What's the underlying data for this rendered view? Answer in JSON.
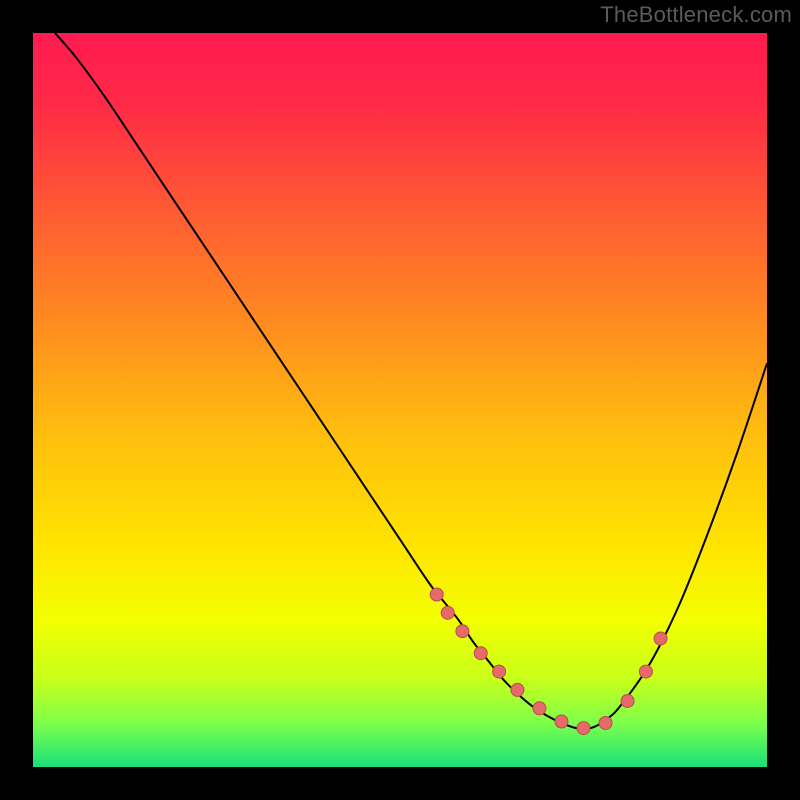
{
  "watermark": "TheBottleneck.com",
  "gradient": {
    "stops": [
      {
        "offset": 0.0,
        "color": "#ff1a51"
      },
      {
        "offset": 0.1,
        "color": "#ff2b46"
      },
      {
        "offset": 0.25,
        "color": "#ff5d32"
      },
      {
        "offset": 0.4,
        "color": "#ff8d1f"
      },
      {
        "offset": 0.55,
        "color": "#ffbf0e"
      },
      {
        "offset": 0.7,
        "color": "#ffe500"
      },
      {
        "offset": 0.8,
        "color": "#f3ff00"
      },
      {
        "offset": 0.88,
        "color": "#c8ff1a"
      },
      {
        "offset": 0.94,
        "color": "#7dff4a"
      },
      {
        "offset": 1.0,
        "color": "#18e07a"
      }
    ]
  },
  "curve_color": "#000000",
  "dot_fill": "#e66a6a",
  "dot_stroke": "#b94c4c",
  "chart_data": {
    "type": "line",
    "title": "",
    "xlabel": "",
    "ylabel": "",
    "xlim": [
      0,
      100
    ],
    "ylim": [
      0,
      100
    ],
    "series": [
      {
        "name": "curve",
        "x": [
          3,
          6,
          10,
          14,
          18,
          22,
          26,
          30,
          34,
          38,
          42,
          46,
          50,
          54,
          56,
          58,
          60,
          62,
          64,
          66,
          68,
          70,
          72,
          74,
          76,
          78,
          80,
          84,
          88,
          92,
          96,
          100
        ],
        "y": [
          100,
          96.5,
          91,
          85,
          79,
          73,
          67,
          61,
          55,
          49,
          43,
          37,
          31,
          25,
          22.5,
          20,
          17,
          14.5,
          12,
          10,
          8.3,
          7,
          6,
          5.3,
          5.3,
          6.4,
          8.3,
          14,
          22,
          32,
          43,
          55
        ]
      },
      {
        "name": "dots",
        "x": [
          55,
          56.5,
          58.5,
          61,
          63.5,
          66,
          69,
          72,
          75,
          78,
          81,
          83.5,
          85.5
        ],
        "y": [
          23.5,
          21,
          18.5,
          15.5,
          13,
          10.5,
          8,
          6.2,
          5.3,
          6,
          9,
          13,
          17.5
        ]
      }
    ]
  }
}
